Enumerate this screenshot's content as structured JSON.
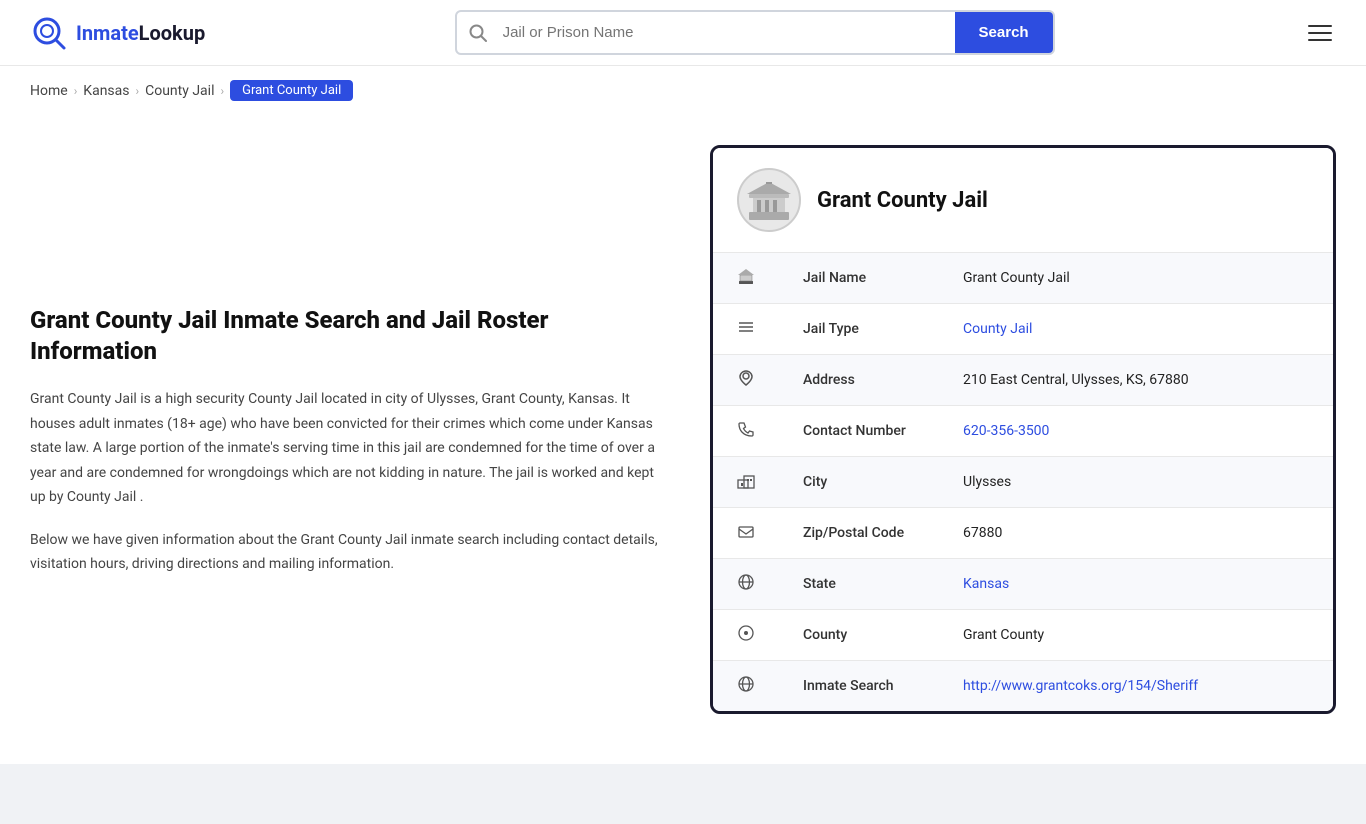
{
  "header": {
    "logo_text": "InmateLookup",
    "logo_text_colored": "Inmate",
    "logo_text_plain": "Lookup",
    "search_placeholder": "Jail or Prison Name",
    "search_button_label": "Search"
  },
  "breadcrumb": {
    "home": "Home",
    "state": "Kansas",
    "type": "County Jail",
    "current": "Grant County Jail"
  },
  "left": {
    "heading": "Grant County Jail Inmate Search and Jail Roster Information",
    "para1": "Grant County Jail is a high security County Jail located in city of Ulysses, Grant County, Kansas. It houses adult inmates (18+ age) who have been convicted for their crimes which come under Kansas state law. A large portion of the inmate's serving time in this jail are condemned for the time of over a year and are condemned for wrongdoings which are not kidding in nature. The jail is worked and kept up by County Jail .",
    "para2": "Below we have given information about the Grant County Jail inmate search including contact details, visitation hours, driving directions and mailing information."
  },
  "card": {
    "title": "Grant County Jail",
    "rows": [
      {
        "icon": "jail-icon",
        "label": "Jail Name",
        "value": "Grant County Jail",
        "link": null
      },
      {
        "icon": "type-icon",
        "label": "Jail Type",
        "value": "County Jail",
        "link": "#"
      },
      {
        "icon": "location-icon",
        "label": "Address",
        "value": "210 East Central, Ulysses, KS, 67880",
        "link": null
      },
      {
        "icon": "phone-icon",
        "label": "Contact Number",
        "value": "620-356-3500",
        "link": "tel:6203563500"
      },
      {
        "icon": "city-icon",
        "label": "City",
        "value": "Ulysses",
        "link": null
      },
      {
        "icon": "zip-icon",
        "label": "Zip/Postal Code",
        "value": "67880",
        "link": null
      },
      {
        "icon": "state-icon",
        "label": "State",
        "value": "Kansas",
        "link": "#"
      },
      {
        "icon": "county-icon",
        "label": "County",
        "value": "Grant County",
        "link": null
      },
      {
        "icon": "web-icon",
        "label": "Inmate Search",
        "value": "http://www.grantcoks.org/154/Sheriff",
        "link": "http://www.grantcoks.org/154/Sheriff"
      }
    ]
  },
  "colors": {
    "accent": "#2d4de0",
    "border_dark": "#1a1a2e"
  }
}
